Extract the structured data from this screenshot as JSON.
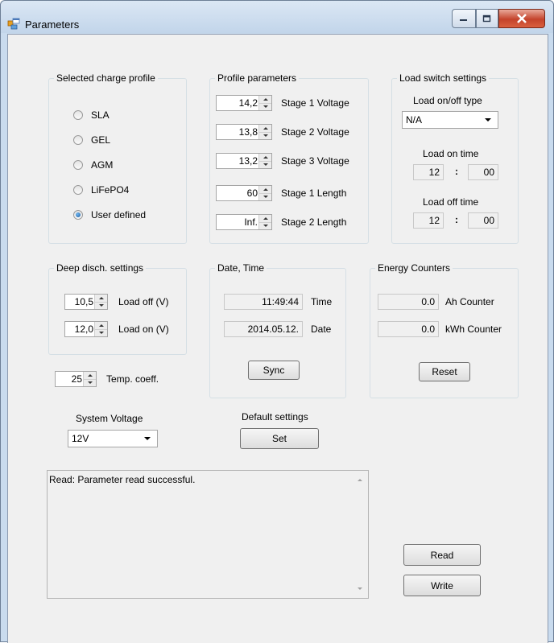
{
  "window": {
    "title": "Parameters"
  },
  "charge_profile": {
    "title": "Selected charge profile",
    "options": [
      "SLA",
      "GEL",
      "AGM",
      "LiFePO4",
      "User defined"
    ],
    "selected": "User defined"
  },
  "profile_params": {
    "title": "Profile parameters",
    "items": [
      {
        "value": "14,2",
        "label": "Stage 1 Voltage"
      },
      {
        "value": "13,8",
        "label": "Stage 2 Voltage"
      },
      {
        "value": "13,2",
        "label": "Stage 3 Voltage"
      },
      {
        "value": "60",
        "label": "Stage 1 Length"
      },
      {
        "value": "Inf.",
        "label": "Stage 2 Length"
      }
    ]
  },
  "load_switch": {
    "title": "Load switch settings",
    "type_label": "Load on/off type",
    "type_value": "N/A",
    "on_label": "Load on time",
    "on_hour": "12",
    "on_min": "00",
    "off_label": "Load off time",
    "off_hour": "12",
    "off_min": "00",
    "separator": ":"
  },
  "deep_disch": {
    "title": "Deep disch. settings",
    "off_value": "10,5",
    "off_label": "Load off (V)",
    "on_value": "12,0",
    "on_label": "Load on (V)"
  },
  "temp": {
    "value": "25",
    "label": "Temp. coeff."
  },
  "datetime": {
    "title": "Date, Time",
    "time_value": "11:49:44",
    "time_label": "Time",
    "date_value": "2014.05.12.",
    "date_label": "Date",
    "sync_label": "Sync"
  },
  "energy": {
    "title": "Energy Counters",
    "ah_value": "0.0",
    "ah_label": "Ah Counter",
    "kwh_value": "0.0",
    "kwh_label": "kWh Counter",
    "reset_label": "Reset"
  },
  "system_voltage": {
    "label": "System Voltage",
    "value": "12V"
  },
  "defaults": {
    "label": "Default settings",
    "button": "Set"
  },
  "log": {
    "text": "Read: Parameter read successful."
  },
  "actions": {
    "read": "Read",
    "write": "Write"
  }
}
